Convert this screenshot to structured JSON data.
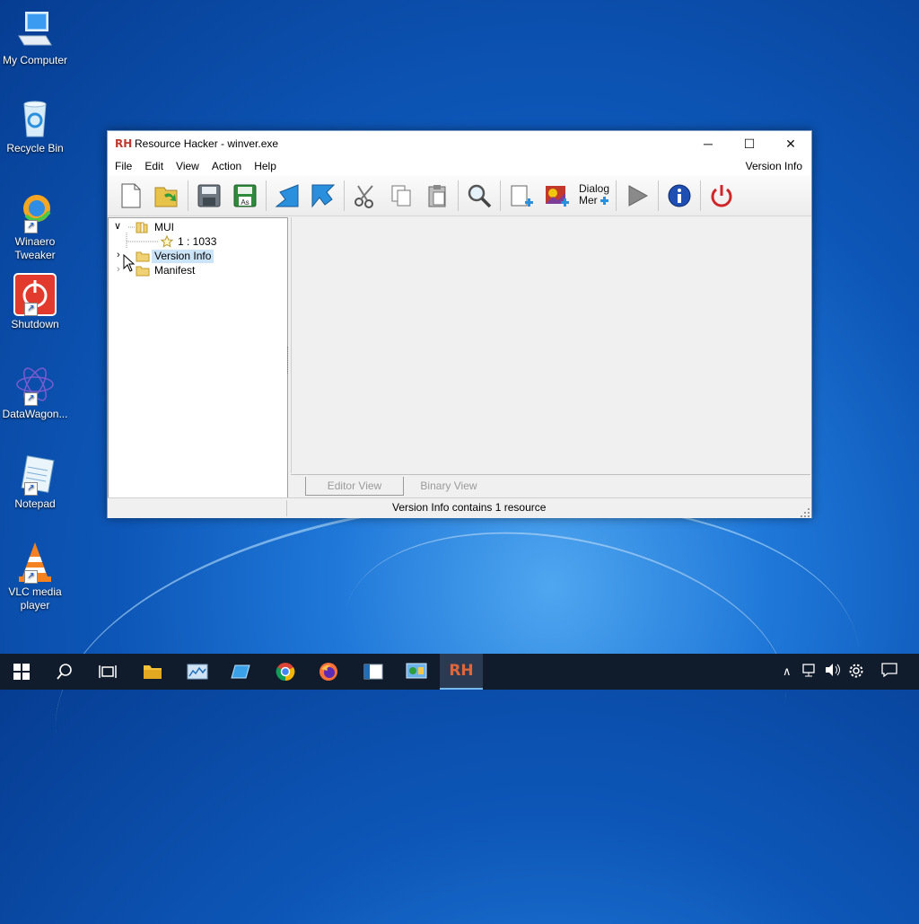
{
  "desktop": {
    "icons": [
      {
        "label": "My Computer",
        "icon": "computer-icon"
      },
      {
        "label": "Recycle Bin",
        "icon": "recycle-bin-icon"
      },
      {
        "label": "Winaero Tweaker",
        "icon": "winaero-icon"
      },
      {
        "label": "Shutdown",
        "icon": "shutdown-icon"
      },
      {
        "label": "DataWagon...",
        "icon": "datawagon-icon"
      },
      {
        "label": "Notepad",
        "icon": "notepad-icon"
      },
      {
        "label": "VLC media player",
        "icon": "vlc-icon"
      }
    ]
  },
  "window": {
    "app_icon": "RH",
    "title": "Resource Hacker - winver.exe",
    "menu": [
      "File",
      "Edit",
      "View",
      "Action",
      "Help"
    ],
    "menu_right": "Version Info",
    "toolbar": {
      "dialog_merge_label_1": "Dialog",
      "dialog_merge_label_2": "Mer"
    },
    "tree": {
      "nodes": [
        {
          "label": "MUI",
          "expanded": true
        },
        {
          "label": "1 : 1033"
        },
        {
          "label": "Version Info",
          "selected": true
        },
        {
          "label": "Manifest"
        }
      ]
    },
    "tabs": [
      "Editor View",
      "Binary View"
    ],
    "status": "Version Info contains 1 resource"
  },
  "colors": {
    "accent": "#1a5fd0",
    "selection": "#cce4f7",
    "taskbar": "#101b2b"
  }
}
